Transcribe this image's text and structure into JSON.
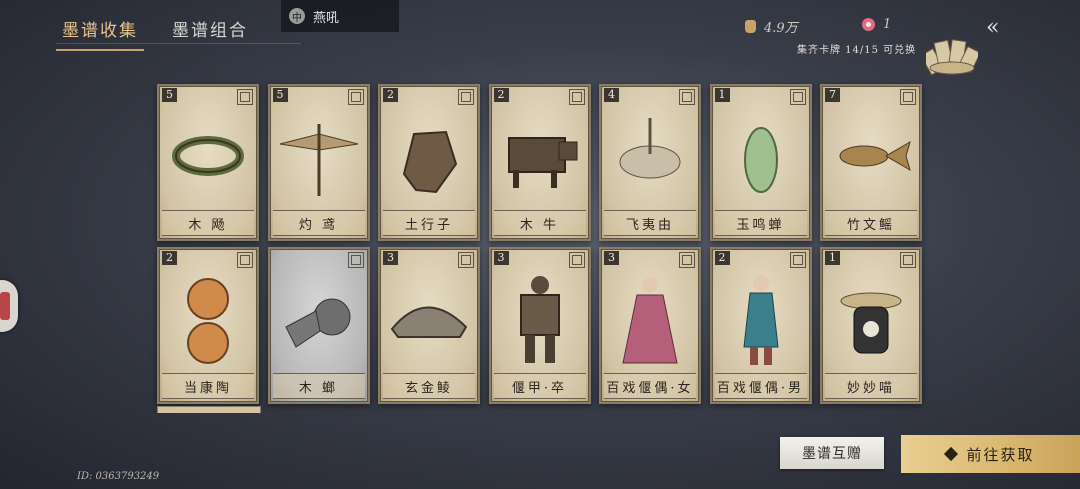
{
  "tabs": [
    {
      "label": "墨谱收集",
      "active": true
    },
    {
      "label": "墨谱组合",
      "active": false
    }
  ],
  "chat": {
    "icon_text": "中",
    "text": "燕吼"
  },
  "currency": [
    {
      "icon": "money-bag-icon",
      "value": "4.9万"
    },
    {
      "icon": "flower-icon",
      "value": "1"
    }
  ],
  "collect_text": "集齐卡牌 14/15 可兑换",
  "cards": [
    {
      "count": "5",
      "name": "木 飏",
      "style": "normal"
    },
    {
      "count": "5",
      "name": "灼 鸢",
      "style": "normal"
    },
    {
      "count": "2",
      "name": "土行子",
      "style": "normal"
    },
    {
      "count": "2",
      "name": "木 牛",
      "style": "normal"
    },
    {
      "count": "4",
      "name": "飞夷由",
      "style": "normal"
    },
    {
      "count": "1",
      "name": "玉鸣蝉",
      "style": "normal"
    },
    {
      "count": "7",
      "name": "竹文鳐",
      "style": "normal"
    },
    {
      "count": "2",
      "name": "当康陶",
      "style": "normal"
    },
    {
      "count": "",
      "name": "木 螂",
      "style": "gray"
    },
    {
      "count": "3",
      "name": "玄金鲮",
      "style": "normal"
    },
    {
      "count": "3",
      "name": "偃甲·卒",
      "style": "normal"
    },
    {
      "count": "3",
      "name": "百戏偃偶·女",
      "style": "normal"
    },
    {
      "count": "2",
      "name": "百戏偃偶·男",
      "style": "normal"
    },
    {
      "count": "1",
      "name": "妙妙喵",
      "style": "normal"
    }
  ],
  "buttons": {
    "gift": "墨谱互赠",
    "get": "前往获取"
  },
  "uid": "ID: 0363793249",
  "colors": {
    "accent": "#e8c48a",
    "gold_button": "#d9b76f",
    "card_bg": "#d2c4a5"
  }
}
